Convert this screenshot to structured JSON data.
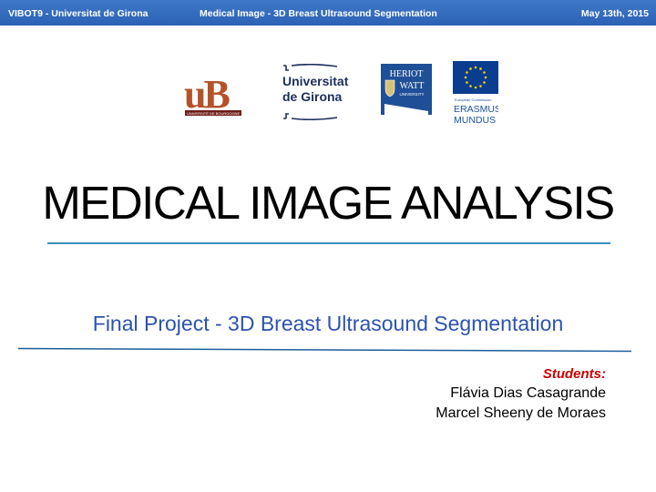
{
  "header": {
    "left": "VIBOT9 - Universitat de Girona",
    "center": "Medical Image - 3D Breast Ultrasound Segmentation",
    "right": "May 13th, 2015"
  },
  "logos": {
    "ub": {
      "icon": "university-of-burgundy-logo",
      "text": "uB",
      "caption": "UNIVERSITÉ DE BOURGOGNE"
    },
    "udg": {
      "icon": "universitat-de-girona-logo",
      "line1": "Universitat",
      "line2": "de Girona"
    },
    "hw": {
      "icon": "heriot-watt-university-logo",
      "line1": "HERIOT",
      "line2": "WATT",
      "line3": "UNIVERSITY"
    },
    "em": {
      "icon": "erasmus-mundus-logo",
      "caption1": "European Commission",
      "line1": "ERASMUS",
      "line2": "MUNDUS"
    }
  },
  "title": "MEDICAL IMAGE ANALYSIS",
  "subtitle": "Final Project - 3D Breast Ultrasound Segmentation",
  "students": {
    "label": "Students:",
    "names": [
      "Flávia Dias Casagrande",
      "Marcel Sheeny de Moraes"
    ]
  },
  "colors": {
    "header_bar": "#2b62b4",
    "subtitle": "#2b53b0",
    "students_label": "#cc0000",
    "rule": "#3a8fc0"
  }
}
